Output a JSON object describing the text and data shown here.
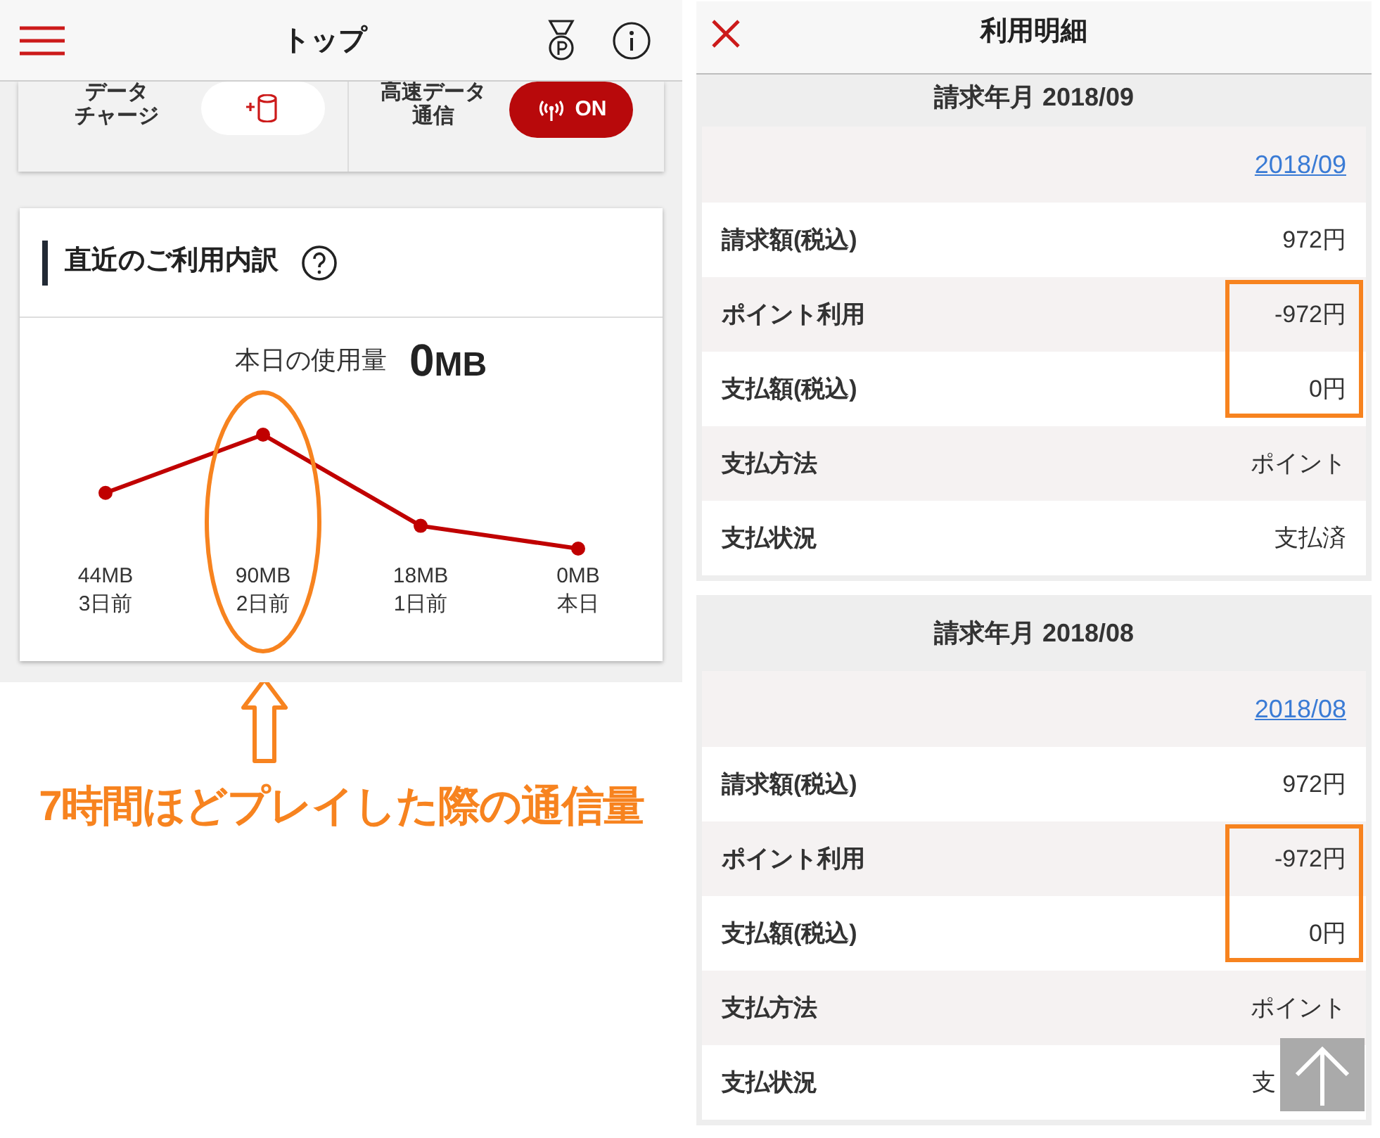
{
  "top_screen": {
    "header": {
      "title": "トップ"
    },
    "quick_actions": [
      {
        "kind": "charge",
        "label_lines": [
          "データ",
          "チャージ"
        ]
      },
      {
        "kind": "toggle",
        "label_lines": [
          "高速データ",
          "通信"
        ],
        "toggle_text": "ON",
        "on": true
      }
    ],
    "usage_card": {
      "title": "直近のご利用内訳",
      "today_label": "本日の使用量",
      "today_amount": "0",
      "today_unit": "MB",
      "chart_data": {
        "type": "line",
        "categories": [
          "3日前",
          "2日前",
          "1日前",
          "本日"
        ],
        "values": [
          44,
          90,
          18,
          0
        ],
        "value_labels": [
          "44MB",
          "90MB",
          "18MB",
          "0MB"
        ],
        "marker": "circle"
      },
      "circled": [
        false,
        true,
        false,
        false
      ]
    }
  },
  "annotation": {
    "text": "7時間ほどプレイした際の通信量"
  },
  "detail_screen": {
    "header": {
      "title": "利用明細"
    },
    "sections": [
      {
        "title": "請求年月 2018/09",
        "link": "2018/09",
        "rows": [
          {
            "label": "請求額(税込)",
            "value": "972円",
            "boxed": false
          },
          {
            "label": "ポイント利用",
            "value": "-972円",
            "boxed": true
          },
          {
            "label": "支払額(税込)",
            "value": "0円",
            "boxed": true
          },
          {
            "label": "支払方法",
            "value": "ポイント",
            "boxed": false
          },
          {
            "label": "支払状況",
            "value": "支払済",
            "boxed": false
          }
        ]
      },
      {
        "title": "請求年月 2018/08",
        "link": "2018/08",
        "rows": [
          {
            "label": "請求額(税込)",
            "value": "972円",
            "boxed": false
          },
          {
            "label": "ポイント利用",
            "value": "-972円",
            "boxed": true
          },
          {
            "label": "支払額(税込)",
            "value": "0円",
            "boxed": true
          },
          {
            "label": "支払方法",
            "value": "ポイント",
            "boxed": false
          },
          {
            "label": "支払状況",
            "value": "支",
            "boxed": false,
            "covered": true
          }
        ]
      }
    ]
  }
}
